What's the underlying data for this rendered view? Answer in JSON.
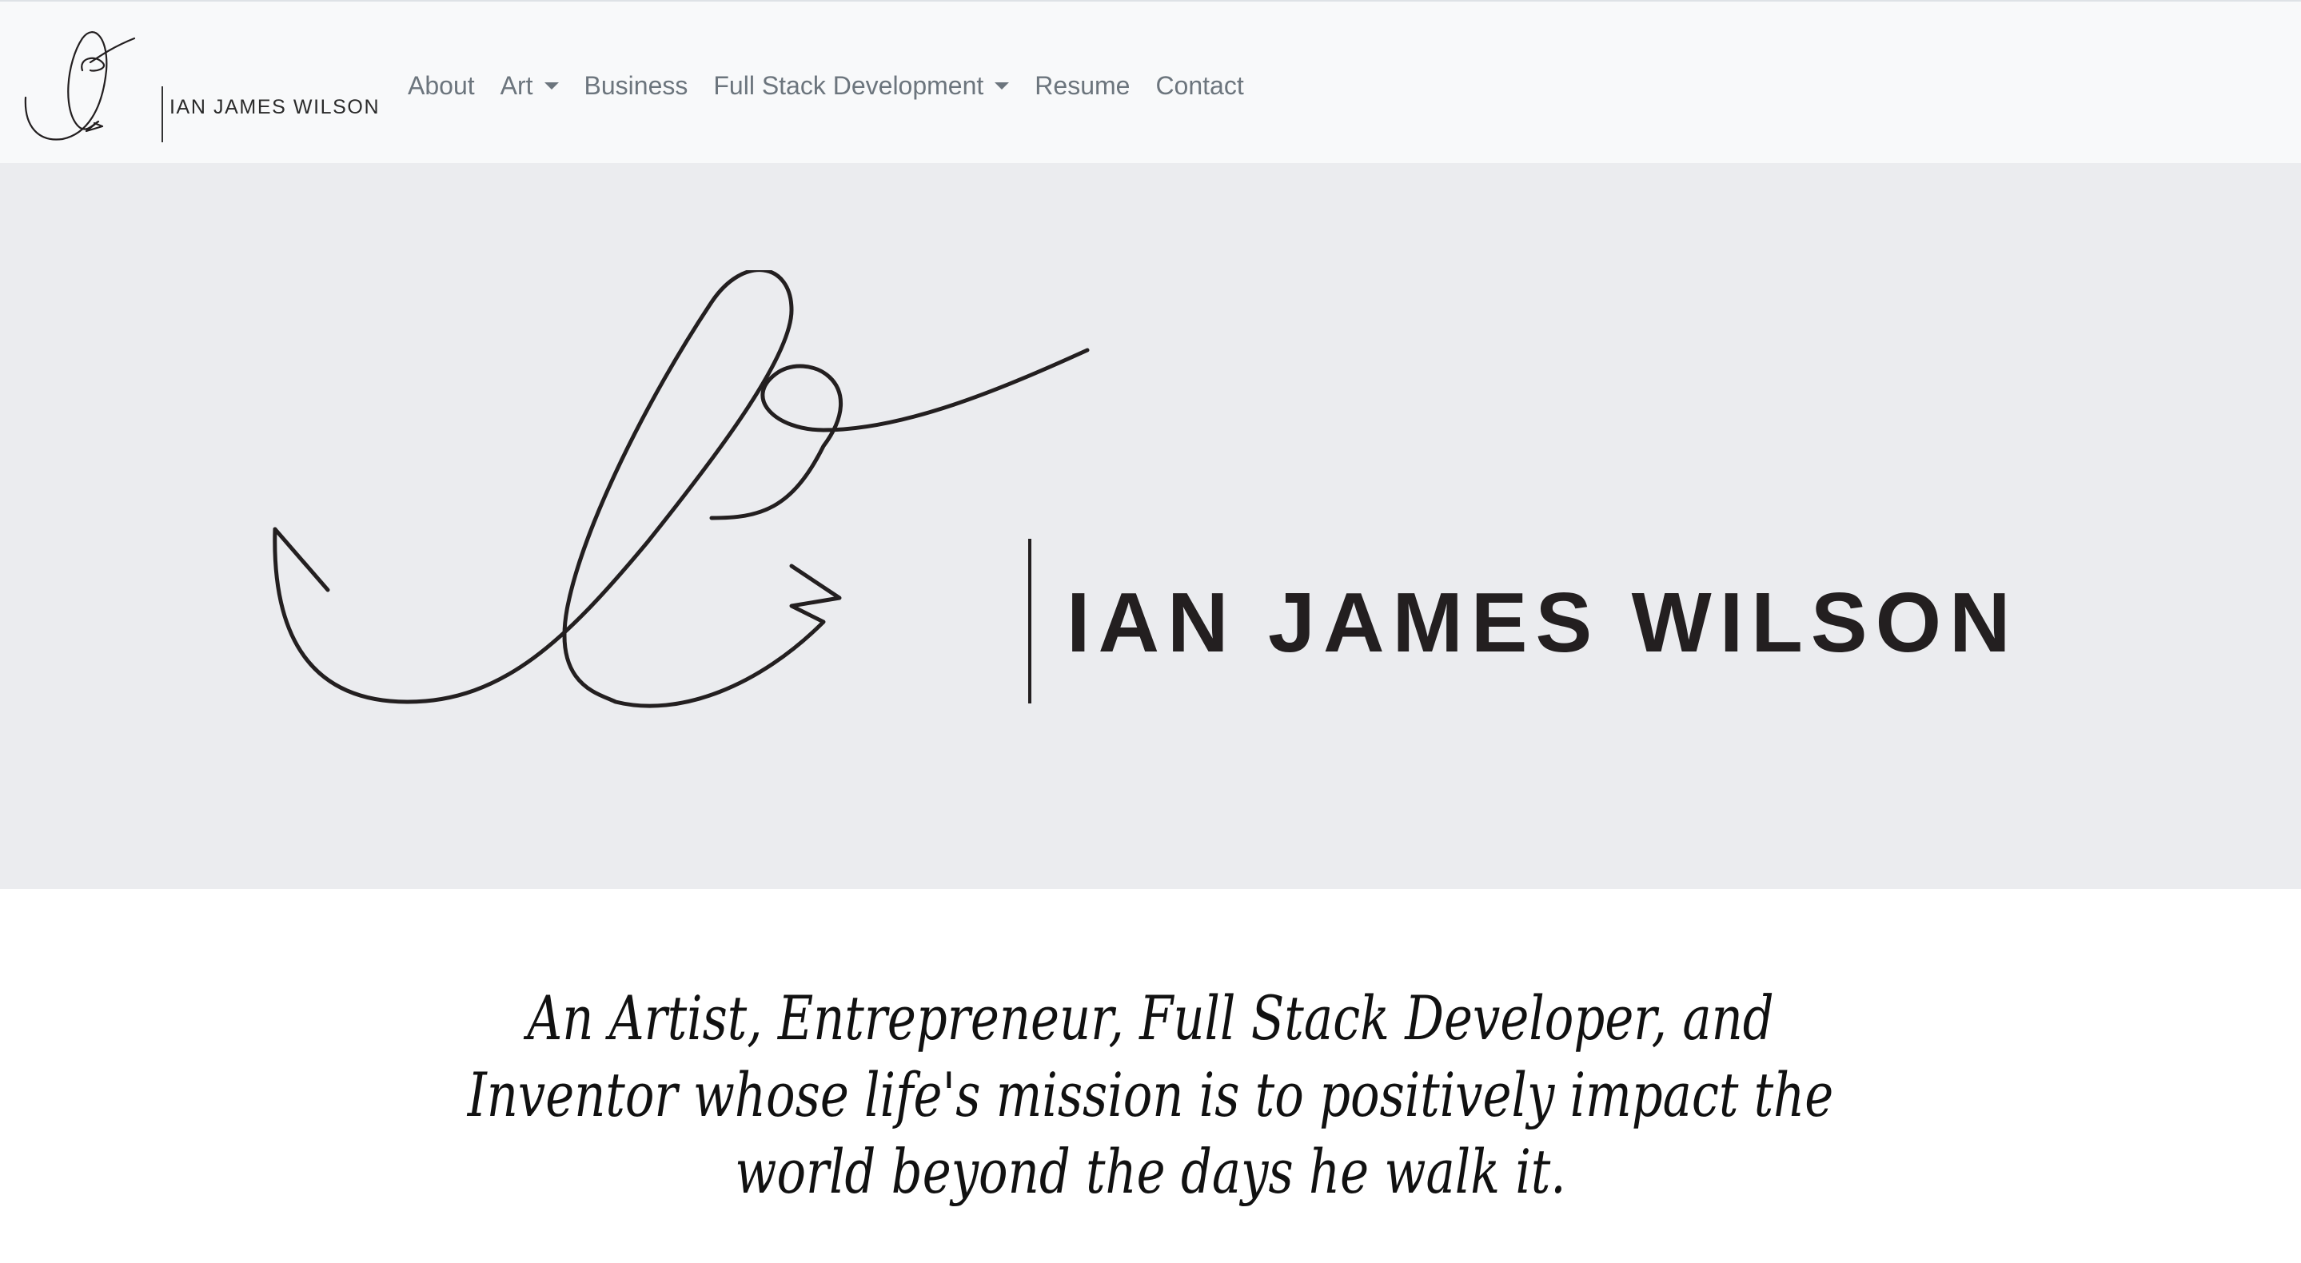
{
  "brand": {
    "name": "IAN JAMES WILSON"
  },
  "nav": {
    "items": [
      {
        "label": "About",
        "dropdown": false
      },
      {
        "label": "Art",
        "dropdown": true
      },
      {
        "label": "Business",
        "dropdown": false
      },
      {
        "label": "Full Stack Development",
        "dropdown": true
      },
      {
        "label": "Resume",
        "dropdown": false
      },
      {
        "label": "Contact",
        "dropdown": false
      }
    ]
  },
  "hero": {
    "name": "IAN JAMES WILSON",
    "background": "#ebecef"
  },
  "tagline": "An Artist, Entrepreneur, Full Stack Developer, and Inventor whose life's mission is to positively impact the world beyond the days he walk it.",
  "colors": {
    "navbar_bg": "#f8f9fa",
    "nav_link": "#6c757d",
    "hero_bg": "#ebecef",
    "ink": "#231f20"
  }
}
